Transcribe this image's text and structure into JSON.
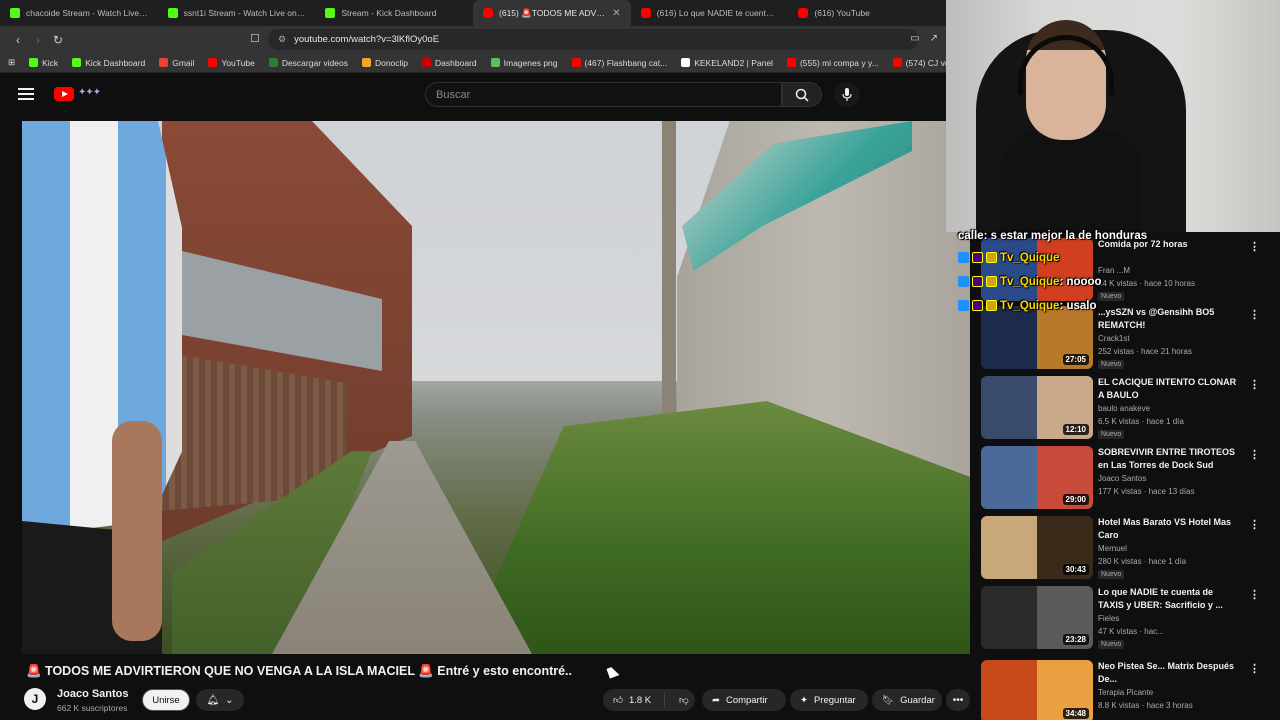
{
  "browser": {
    "tabs": [
      {
        "title": "chacoide Stream - Watch Live on",
        "icon": "kick",
        "active": false
      },
      {
        "title": "ssnt1i Stream - Watch Live on Ki",
        "icon": "kick",
        "active": false
      },
      {
        "title": "Stream - Kick Dashboard",
        "icon": "kick",
        "active": false
      },
      {
        "title": "(615) 🚨TODOS ME ADVIRTI",
        "icon": "youtube",
        "active": true
      },
      {
        "title": "(616) Lo que NADIE te cuenta de TA",
        "icon": "youtube",
        "active": false
      },
      {
        "title": "(616) YouTube",
        "icon": "youtube",
        "active": false
      }
    ],
    "url": "youtube.com/watch?v=3lKflOy0oE",
    "bookmarks": [
      {
        "label": "Kick",
        "color": "#53fc18"
      },
      {
        "label": "Kick Dashboard",
        "color": "#53fc18"
      },
      {
        "label": "Gmail",
        "color": "#ea4335"
      },
      {
        "label": "YouTube",
        "color": "#ff0000"
      },
      {
        "label": "Descargar videos",
        "color": "#2e7d32"
      },
      {
        "label": "Donoclip",
        "color": "#f5a623"
      },
      {
        "label": "Dashboard",
        "color": "#cc0000"
      },
      {
        "label": "Imagenes png",
        "color": "#5fbf5f"
      },
      {
        "label": "(467) Flashbang cat...",
        "color": "#ff0000"
      },
      {
        "label": "KEKELAND2 | Panel",
        "color": "#ffffff"
      },
      {
        "label": "(555) mi compa y y...",
        "color": "#ff0000"
      },
      {
        "label": "(574) CJ volando en...",
        "color": "#ff0000"
      }
    ]
  },
  "youtube": {
    "search_placeholder": "Buscar",
    "video_title": "🚨 TODOS ME ADVIRTIERON QUE NO VENGA A LA ISLA MACIEL 🚨 Entré y esto encontré..",
    "channel": {
      "name": "Joaco Santos",
      "subs": "662 K suscriptores",
      "avatar_letter": "J"
    },
    "join_label": "Unirse",
    "likes": "1.8 K",
    "share_label": "Compartir",
    "ask_label": "Preguntar",
    "save_label": "Guardar"
  },
  "recommendations": [
    {
      "title": "Comida por 72 horas",
      "channel": "Fran ...M",
      "meta": "44 K vistas · hace 10 horas",
      "duration": "",
      "badge": "Nuevo",
      "thumb_colors": [
        "#2a4a8a",
        "#d04020"
      ]
    },
    {
      "title": "...ysSZN vs @Gensihh  BO5 REMATCH!",
      "channel": "Crack1st",
      "meta": "252 vistas · hace 21 horas",
      "duration": "27:05",
      "badge": "Nuevo",
      "thumb_colors": [
        "#1c2a4c",
        "#b87a2a"
      ]
    },
    {
      "title": "EL CACIQUE INTENTO CLONAR A BAULO",
      "channel": "baulo anakeve",
      "meta": "6.5 K vistas · hace 1 día",
      "duration": "12:10",
      "badge": "Nuevo",
      "thumb_colors": [
        "#3a4a6a",
        "#c9a98a"
      ]
    },
    {
      "title": "SOBREVIVIR ENTRE TIROTEOS en Las Torres de Dock Sud",
      "channel": "Joaco Santos",
      "meta": "177 K vistas · hace 13 días",
      "duration": "29:00",
      "badge": "",
      "thumb_colors": [
        "#4a6a9a",
        "#c84a3a"
      ]
    },
    {
      "title": "Hotel Mas Barato VS Hotel Mas Caro",
      "channel": "Mernuel",
      "meta": "280 K vistas · hace 1 día",
      "duration": "30:43",
      "badge": "Nuevo",
      "thumb_colors": [
        "#c8a878",
        "#3a2a1a"
      ]
    },
    {
      "title": "Lo que NADIE te cuenta de TAXIS y UBER: Sacrificio y ...",
      "channel": "Fieles",
      "meta": "47 K vistas · hac...",
      "duration": "23:28",
      "badge": "Nuevo",
      "thumb_colors": [
        "#2a2a2a",
        "#5a5a5a"
      ]
    },
    {
      "title": "Neo Pistea Se... Matrix Después De...",
      "channel": "Terapia Picante",
      "meta": "8.8 K vistas · hace 3 horas",
      "duration": "34:48",
      "badge": "",
      "thumb_colors": [
        "#c84a1a",
        "#e8a040"
      ]
    }
  ],
  "chat": [
    {
      "user": "",
      "text": "calle: s estar mejor la de honduras"
    },
    {
      "user": "Tv_Quique",
      "text": ""
    },
    {
      "user": "Tv_Quique",
      "text": ": noooo"
    },
    {
      "user": "Tv_Quique",
      "text": ": usalo"
    }
  ]
}
